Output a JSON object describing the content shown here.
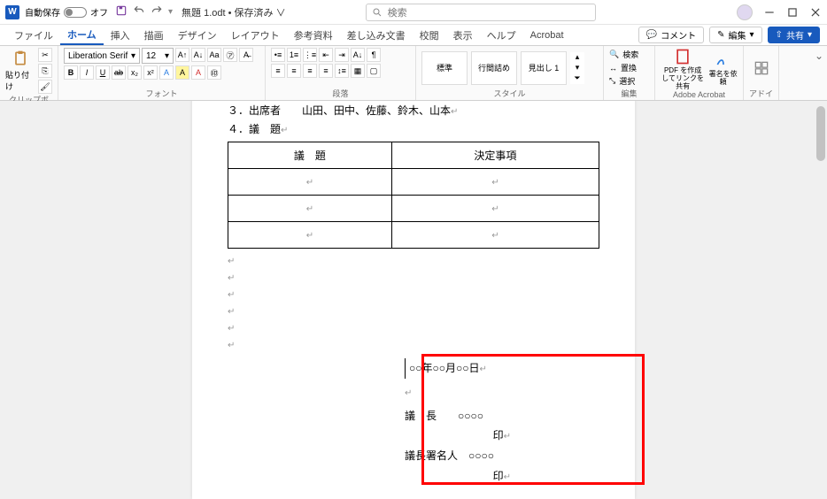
{
  "titlebar": {
    "autosave_label": "自動保存",
    "autosave_state": "オフ",
    "doc_title": "無題 1.odt • 保存済み ∨",
    "search_placeholder": "検索"
  },
  "tabs": {
    "items": [
      "ファイル",
      "ホーム",
      "挿入",
      "描画",
      "デザイン",
      "レイアウト",
      "参考資料",
      "差し込み文書",
      "校閲",
      "表示",
      "ヘルプ",
      "Acrobat"
    ],
    "active_index": 1,
    "comment_btn": "コメント",
    "edit_btn": "編集",
    "share_btn": "共有"
  },
  "ribbon": {
    "clipboard": {
      "paste": "貼り付け",
      "label": "クリップボード"
    },
    "font": {
      "name": "Liberation Serif",
      "size": "12",
      "label": "フォント"
    },
    "paragraph": {
      "label": "段落"
    },
    "styles": {
      "items": [
        "標準",
        "行間詰め",
        "見出し 1"
      ],
      "label": "スタイル"
    },
    "editing": {
      "find": "検索",
      "replace": "置換",
      "select": "選択",
      "label": "編集"
    },
    "acrobat": {
      "create": "PDF を作成してリンクを共有",
      "sign": "署名を依頼",
      "label": "Adobe Acrobat"
    },
    "addin": {
      "label": "アドイン"
    }
  },
  "document": {
    "line3_num": "３．出席者",
    "line3_val": "山田、田中、佐藤、鈴木、山本",
    "line4": "４．議　題",
    "th1": "議　題",
    "th2": "決定事項",
    "date": "○○年○○月○○日",
    "chair_label": "議　長",
    "chair_val": "○○○○",
    "seal": "印",
    "signer_label": "議長署名人",
    "signer_val": "○○○○"
  }
}
